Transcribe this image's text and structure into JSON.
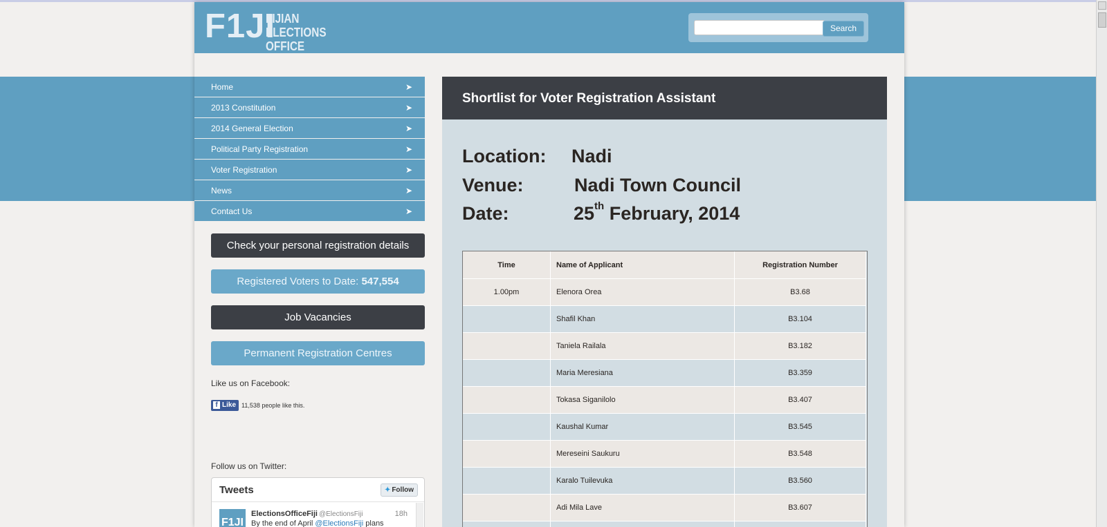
{
  "logo": {
    "mark": "F1JI",
    "text_line1": "FIJIAN",
    "text_line2": "ELECTIONS OFFICE"
  },
  "search": {
    "value": "",
    "placeholder": "",
    "button": "Search"
  },
  "nav": {
    "items": [
      {
        "label": "Home"
      },
      {
        "label": "2013 Constitution"
      },
      {
        "label": "2014 General Election"
      },
      {
        "label": "Political Party Registration"
      },
      {
        "label": "Voter Registration"
      },
      {
        "label": "News"
      },
      {
        "label": "Contact Us"
      }
    ],
    "arrow": "➤"
  },
  "sidebar": {
    "check_details": "Check your personal registration details",
    "registered_label": "Registered Voters to Date:",
    "registered_count": "547,554",
    "job_vacancies": "Job Vacancies",
    "permanent_centres": "Permanent Registration Centres",
    "facebook_label": "Like us on Facebook:",
    "fb_like": "Like",
    "fb_count": "11,538 people like this.",
    "twitter_label": "Follow us on Twitter:"
  },
  "twitter": {
    "title": "Tweets",
    "follow": "Follow",
    "tweet_name": "ElectionsOfficeFiji",
    "tweet_handle": "@ElectionsFiji",
    "tweet_time": "18h",
    "tweet_text_start": "By the end of April ",
    "tweet_mention": "@ElectionsFiji",
    "tweet_text_end": " plans"
  },
  "content": {
    "title": "Shortlist for Voter Registration Assistant",
    "location_label": "Location:",
    "location_value": "Nadi",
    "venue_label": "Venue:",
    "venue_value": "Nadi Town Council",
    "date_label": "Date:",
    "date_day": "25",
    "date_suffix": "th",
    "date_rest": " February, 2014"
  },
  "table": {
    "headers": [
      "Time",
      "Name of Applicant",
      "Registration Number"
    ],
    "rows": [
      [
        "1.00pm",
        "Elenora Orea",
        "B3.68"
      ],
      [
        "",
        "Shafil Khan",
        "B3.104"
      ],
      [
        "",
        "Taniela Railala",
        "B3.182"
      ],
      [
        "",
        "Maria Meresiana",
        "B3.359"
      ],
      [
        "",
        "Tokasa Siganilolo",
        "B3.407"
      ],
      [
        "",
        "Kaushal Kumar",
        "B3.545"
      ],
      [
        "",
        "Mereseini Saukuru",
        "B3.548"
      ],
      [
        "",
        "Karalo Tuilevuka",
        "B3.560"
      ],
      [
        "",
        "Adi Mila Lave",
        "B3.607"
      ],
      [
        "",
        "",
        ""
      ]
    ]
  },
  "colors": {
    "brand_blue": "#5f9fc1",
    "dark": "#3c3f45",
    "content_bg": "#d2dde3",
    "page_bg": "#f2f0ee"
  }
}
